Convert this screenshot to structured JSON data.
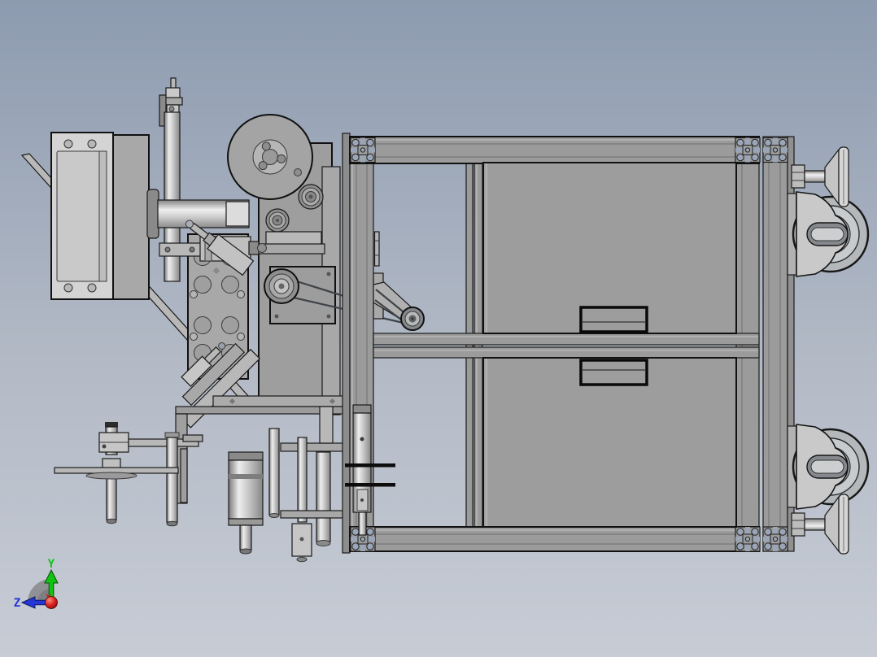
{
  "viewport": {
    "view_type": "side-view-3d-model",
    "content": "machine assembly on extrusion frame with casters"
  },
  "triad": {
    "y_axis_label": "Y",
    "z_axis_label": "Z",
    "y_axis_color": "#12c412",
    "z_axis_color": "#2436d6",
    "x_axis_color": "#cc2020",
    "origin_ball_color": "#c01010",
    "arc_color": "#898b8e"
  },
  "colors": {
    "background_top": "#8d9bb0",
    "background_mid": "#b3bac6",
    "background_bottom": "#c7ccd5",
    "frame_gray": "#9b9b9b",
    "panel_gray": "#9d9d9d",
    "extrusion_slot_sky": "#9aa6b8",
    "light_metal": "#d4d4d4",
    "mid_metal": "#b0b0b0",
    "dark_bar": "#0c0c0c",
    "outline": "#1a1a1a"
  },
  "parts": {
    "visible_components": [
      "aluminum-extrusion-frame",
      "upper-door-panel",
      "lower-door-panel",
      "door-handle-upper",
      "door-handle-lower",
      "swivel-caster-top",
      "swivel-caster-bottom",
      "leveling-foot-top",
      "leveling-foot-bottom",
      "electrical-box",
      "feed-reel-disc",
      "drive-shaft",
      "perforated-tooling-plate",
      "pneumatic-cylinders",
      "belt-drive-arm",
      "orientation-triad"
    ]
  }
}
